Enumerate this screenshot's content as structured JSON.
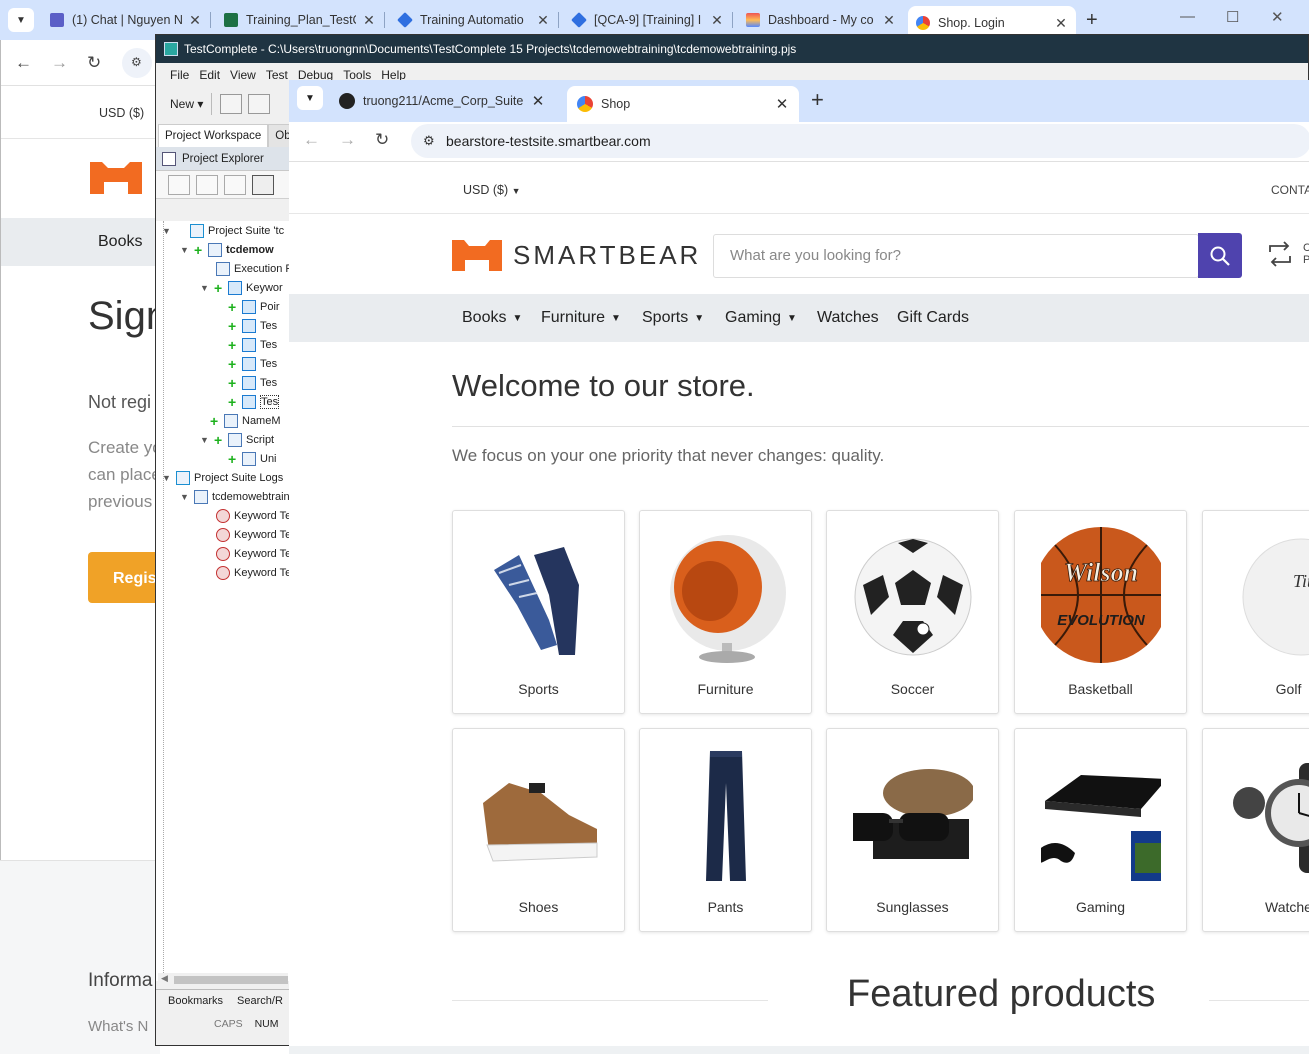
{
  "back_browser": {
    "tabs": [
      {
        "title": "(1) Chat | Nguyen N"
      },
      {
        "title": "Training_Plan_TestC"
      },
      {
        "title": "Training Automatio"
      },
      {
        "title": "[QCA-9] [Training] I"
      },
      {
        "title": "Dashboard - My co"
      },
      {
        "title": "Shop. Login"
      }
    ],
    "page": {
      "currency": "USD  ($)",
      "nav_first": "Books",
      "heading": "Sign",
      "not_registered": "Not regi",
      "create_text": "Create yo can place previous",
      "register_button": "Regist",
      "footer_info": "Informa",
      "footer_whats": "What's N"
    }
  },
  "testcomplete": {
    "title": "TestComplete - C:\\Users\\truongnn\\Documents\\TestComplete 15 Projects\\tcdemowebtraining\\tcdemowebtraining.pjs",
    "menu": [
      "File",
      "Edit",
      "View",
      "Test",
      "Debug",
      "Tools",
      "Help"
    ],
    "new_button": "New",
    "workspace_tabs": [
      "Project Workspace",
      "Obje"
    ],
    "panel_title": "Project Explorer",
    "tree": [
      {
        "label": "Project Suite 'tc",
        "level": 0
      },
      {
        "label": "tcdemow",
        "level": 1
      },
      {
        "label": "Execution P",
        "level": 2
      },
      {
        "label": "Keywor",
        "level": 2
      },
      {
        "label": "Poir",
        "level": 3
      },
      {
        "label": "Tes",
        "level": 3
      },
      {
        "label": "Tes",
        "level": 3
      },
      {
        "label": "Tes",
        "level": 3
      },
      {
        "label": "Tes",
        "level": 3
      },
      {
        "label": "Tes",
        "level": 3
      },
      {
        "label": "NameM",
        "level": 2
      },
      {
        "label": "Script",
        "level": 2
      },
      {
        "label": "Uni",
        "level": 3
      },
      {
        "label": "Project Suite Logs",
        "level": 0
      },
      {
        "label": "tcdemowebtrain",
        "level": 1
      },
      {
        "label": "Keyword Te",
        "level": 2
      },
      {
        "label": "Keyword Te",
        "level": 2
      },
      {
        "label": "Keyword Te",
        "level": 2
      },
      {
        "label": "Keyword Te",
        "level": 2
      }
    ],
    "bottom_tabs": [
      "Bookmarks",
      "Search/R"
    ],
    "status": [
      "CAPS",
      "NUM"
    ]
  },
  "shop_browser": {
    "tabs": [
      {
        "title": "truong211/Acme_Corp_Suite"
      },
      {
        "title": "Shop"
      }
    ],
    "url": "bearstore-testsite.smartbear.com",
    "currency": "USD  ($)",
    "contact": "CONTA",
    "brand": "SMARTBEAR",
    "search_placeholder": "What are you looking for?",
    "compare_label": "C P",
    "menu": [
      {
        "label": "Books",
        "chevron": true
      },
      {
        "label": "Furniture",
        "chevron": true
      },
      {
        "label": "Sports",
        "chevron": true
      },
      {
        "label": "Gaming",
        "chevron": true
      },
      {
        "label": "Watches",
        "chevron": false
      },
      {
        "label": "Gift Cards",
        "chevron": false
      }
    ],
    "welcome": "Welcome to our store.",
    "tagline": "We focus on your one priority that never changes: quality.",
    "categories": [
      {
        "label": "Sports"
      },
      {
        "label": "Furniture"
      },
      {
        "label": "Soccer"
      },
      {
        "label": "Basketball"
      },
      {
        "label": "Golf"
      },
      {
        "label": "Shoes"
      },
      {
        "label": "Pants"
      },
      {
        "label": "Sunglasses"
      },
      {
        "label": "Gaming"
      },
      {
        "label": "Watche"
      }
    ],
    "featured": "Featured products",
    "colors": {
      "accent": "#4f43ae",
      "brand_orange": "#f26b21",
      "register": "#f0a227"
    }
  }
}
